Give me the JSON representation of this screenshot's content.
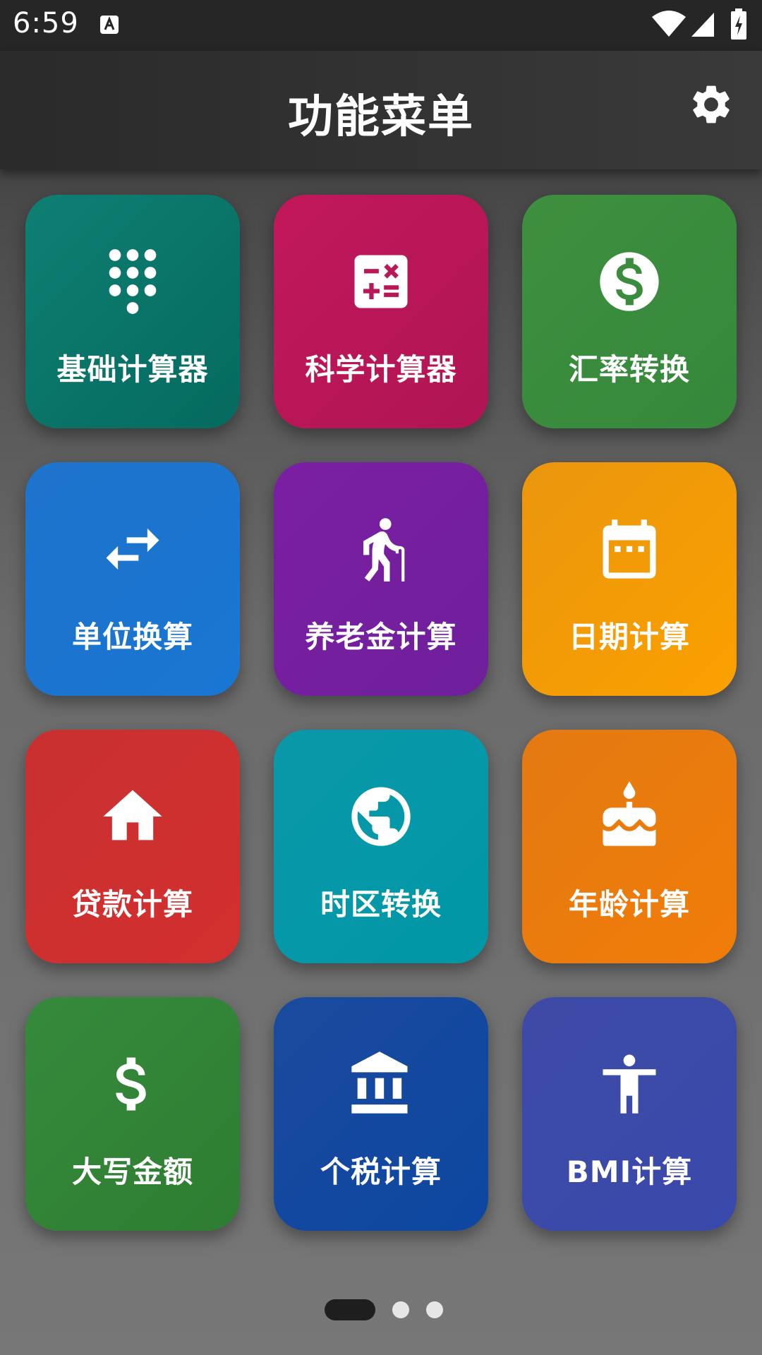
{
  "status_bar": {
    "time": "6:59",
    "icons": [
      "accessibility-app-icon",
      "wifi-icon",
      "signal-icon",
      "battery-charging-icon"
    ]
  },
  "app_bar": {
    "title": "功能菜单",
    "settings_icon": "gear-icon"
  },
  "tiles": [
    {
      "label": "基础计算器",
      "icon": "dialpad-icon",
      "color": "#0b7a6e"
    },
    {
      "label": "科学计算器",
      "icon": "calculator-icon",
      "color": "#c2185b"
    },
    {
      "label": "汇率转换",
      "icon": "dollar-circle-icon",
      "color": "#388e3c"
    },
    {
      "label": "单位换算",
      "icon": "swap-arrows-icon",
      "color": "#1976d2"
    },
    {
      "label": "养老金计算",
      "icon": "elderly-person-icon",
      "color": "#7b1fa2"
    },
    {
      "label": "日期计算",
      "icon": "calendar-icon",
      "color": "#f29a0e"
    },
    {
      "label": "贷款计算",
      "icon": "house-icon",
      "color": "#d32f2f"
    },
    {
      "label": "时区转换",
      "icon": "globe-icon",
      "color": "#0097a7"
    },
    {
      "label": "年龄计算",
      "icon": "birthday-cake-icon",
      "color": "#ef7a12"
    },
    {
      "label": "大写金额",
      "icon": "dollar-sign-icon",
      "color": "#2e7d32"
    },
    {
      "label": "个税计算",
      "icon": "bank-icon",
      "color": "#0d47a1"
    },
    {
      "label": "BMI计算",
      "icon": "accessibility-person-icon",
      "color": "#3949ab"
    }
  ],
  "pager": {
    "pages": 3,
    "current": 1
  }
}
